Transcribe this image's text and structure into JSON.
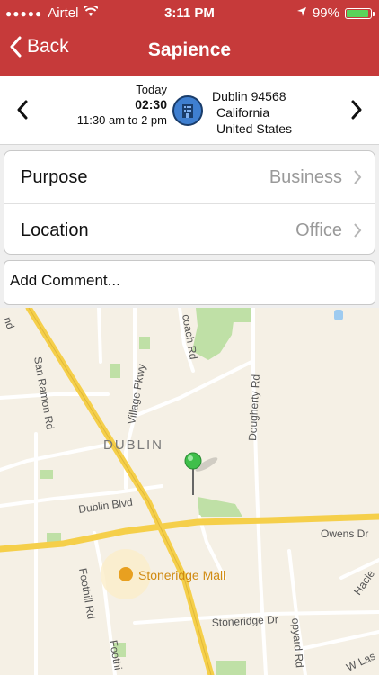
{
  "status": {
    "carrier": "Airtel",
    "time": "3:11 PM",
    "battery": "99%",
    "battery_level": 0.99
  },
  "nav": {
    "back": "Back",
    "title": "Sapience"
  },
  "visit": {
    "day": "Today",
    "duration": "02:30",
    "range": "11:30 am to 2 pm",
    "address_line1": "Dublin 94568",
    "address_line2": "California",
    "address_line3": "United States"
  },
  "form": {
    "purpose_label": "Purpose",
    "purpose_value": "Business",
    "location_label": "Location",
    "location_value": "Office",
    "comment_placeholder": "Add Comment..."
  },
  "map": {
    "city": "DUBLIN",
    "mall": "Stoneridge Mall",
    "streets": {
      "san_ramon": "San Ramon Rd",
      "village": "Village Pkwy",
      "coach": "coach Rd",
      "dougherty": "Dougherty Rd",
      "dublin_blvd": "Dublin Blvd",
      "owens": "Owens Dr",
      "foothill": "Foothill Rd",
      "foothill2": "Foothi",
      "stoneridge": "Stoneridge Dr",
      "hopyard": "opyard Rd",
      "hacie": "Hacie",
      "wlas": "W Las",
      "nd": "nd"
    },
    "colors": {
      "highway": "#f5cf4a",
      "road": "#ffffff",
      "park": "#bfe0a6",
      "water": "#9ecbf0",
      "pin": "#3fbf4a"
    }
  }
}
